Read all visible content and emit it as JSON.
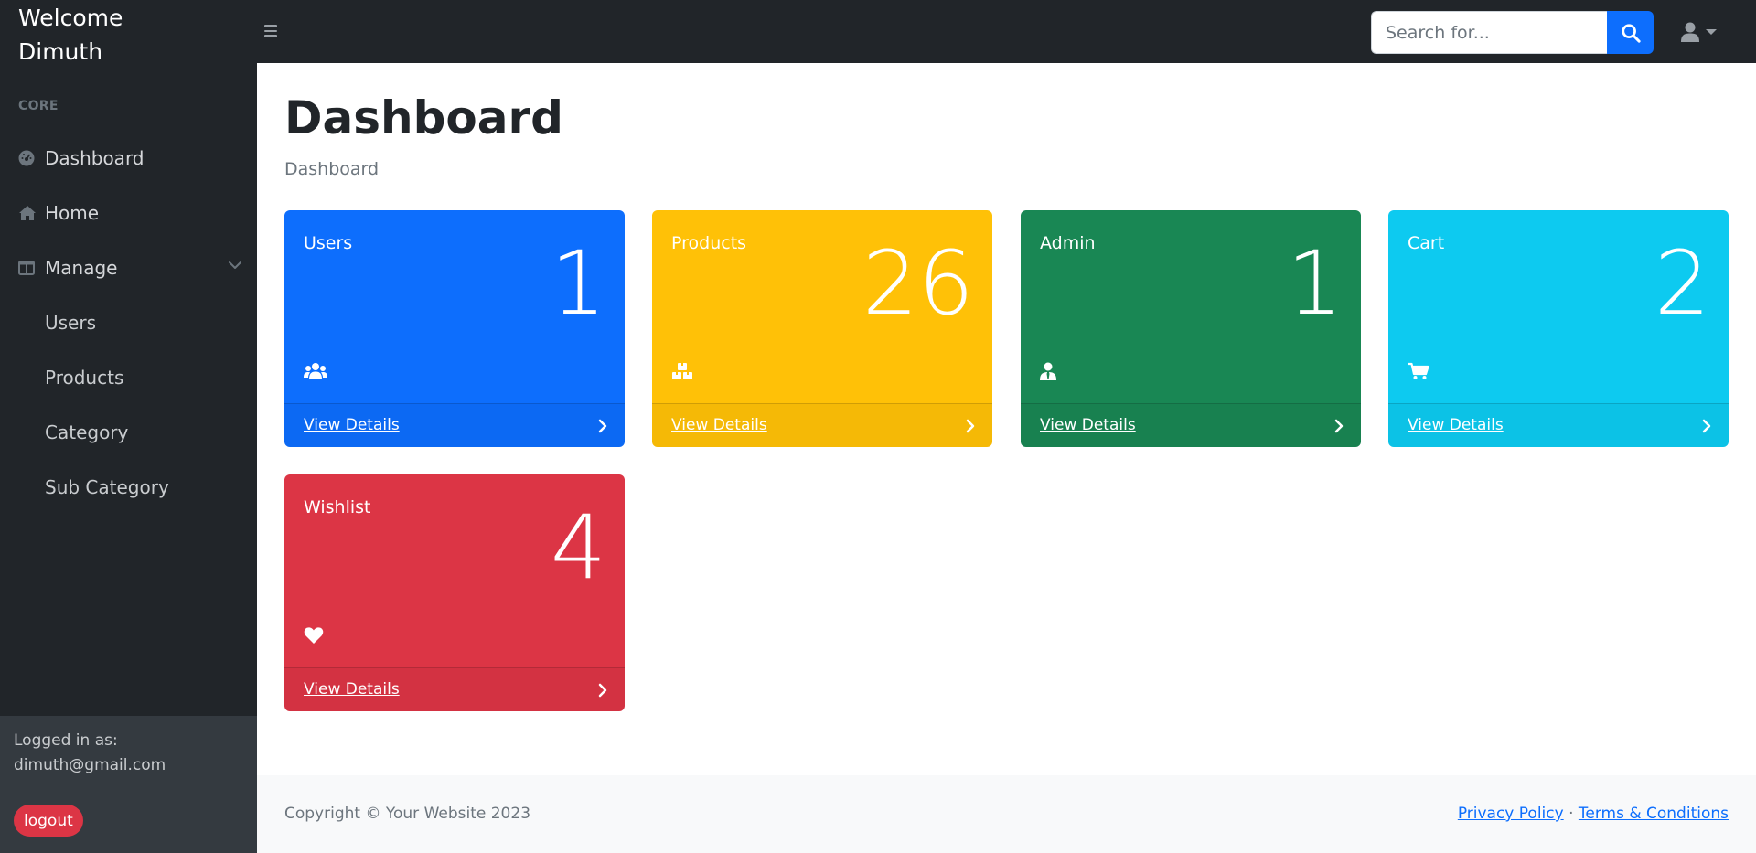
{
  "brand": {
    "line1": "Welcome",
    "line2": "Dimuth"
  },
  "search": {
    "placeholder": "Search for..."
  },
  "sidebar": {
    "heading": "CORE",
    "items": [
      {
        "label": "Dashboard",
        "icon": "tachometer-icon"
      },
      {
        "label": "Home",
        "icon": "home-icon"
      },
      {
        "label": "Manage",
        "icon": "columns-icon"
      }
    ],
    "sub_items": [
      {
        "label": "Users"
      },
      {
        "label": "Products"
      },
      {
        "label": "Category"
      },
      {
        "label": "Sub Category"
      }
    ],
    "footer": {
      "logged_label": "Logged in as:",
      "email": "dimuth@gmail.com",
      "logout_label": "logout"
    }
  },
  "main": {
    "title": "Dashboard",
    "breadcrumb": "Dashboard",
    "cards": [
      {
        "title": "Users",
        "value": "1",
        "link": "View Details",
        "icon": "users-icon",
        "color": "#0d6efd"
      },
      {
        "title": "Products",
        "value": "26",
        "link": "View Details",
        "icon": "boxes-icon",
        "color": "#ffc107"
      },
      {
        "title": "Admin",
        "value": "1",
        "link": "View Details",
        "icon": "user-tie-icon",
        "color": "#198754"
      },
      {
        "title": "Cart",
        "value": "2",
        "link": "View Details",
        "icon": "cart-icon",
        "color": "#0dcaf0"
      },
      {
        "title": "Wishlist",
        "value": "4",
        "link": "View Details",
        "icon": "heart-icon",
        "color": "#dc3545"
      }
    ]
  },
  "footer": {
    "copyright": "Copyright © Your Website 2023",
    "privacy": "Privacy Policy",
    "separator": "·",
    "terms": "Terms & Conditions"
  }
}
